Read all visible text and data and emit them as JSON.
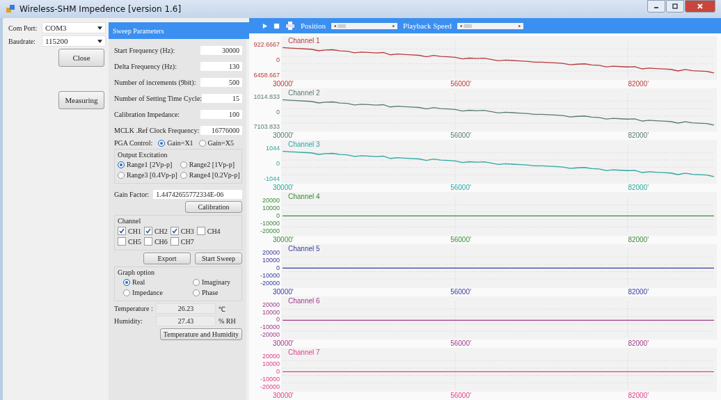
{
  "window": {
    "title": "Wireless-SHM Impedence [version 1.6]"
  },
  "connection": {
    "com_port": {
      "label": "Com Port:",
      "value": "COM3"
    },
    "baudrate": {
      "label": "Baudrate:",
      "value": "115200"
    },
    "close_button": "Close",
    "measuring_button": "Measuring"
  },
  "sweep": {
    "header": "Sweep Parameters",
    "fields": [
      {
        "label": "Start Frequency (Hz):",
        "value": "30000"
      },
      {
        "label": "Delta Frequency (Hz):",
        "value": "130"
      },
      {
        "label": "Number of increments (9bit):",
        "value": "500"
      },
      {
        "label": "Number of Setting Time Cycle:",
        "value": "15"
      },
      {
        "label": "Calibration Impedance:",
        "value": "100"
      },
      {
        "label": "MCLK .Ref Clock Frequency:",
        "value": "16776000"
      }
    ],
    "pga": {
      "label": "PGA Control:",
      "options": [
        {
          "label": "Gain=X1",
          "selected": true
        },
        {
          "label": "Gain=X5",
          "selected": false
        }
      ]
    },
    "output_excitation": {
      "title": "Output Excitation",
      "options": [
        {
          "label": "Range1 [2Vp-p]",
          "selected": true
        },
        {
          "label": "Range2 [1Vp-p]",
          "selected": false
        },
        {
          "label": "Range3 [0.4Vp-p]",
          "selected": false
        },
        {
          "label": "Range4 [0.2Vp-p]",
          "selected": false
        }
      ]
    },
    "gain_factor": {
      "label": "Gain Factor:",
      "value": "1.44742655772334E-06"
    },
    "calibration_button": "Calibration",
    "channel": {
      "title": "Channel",
      "items": [
        {
          "label": "CH1",
          "checked": true
        },
        {
          "label": "CH2",
          "checked": true
        },
        {
          "label": "CH3",
          "checked": true
        },
        {
          "label": "CH4",
          "checked": false
        },
        {
          "label": "CH5",
          "checked": false
        },
        {
          "label": "CH6",
          "checked": false
        },
        {
          "label": "CH7",
          "checked": false
        }
      ]
    },
    "export_button": "Export",
    "start_sweep_button": "Start Sweep",
    "graph_option": {
      "title": "Graph option",
      "options": [
        {
          "label": "Real",
          "selected": true
        },
        {
          "label": "Imaginary",
          "selected": false
        },
        {
          "label": "Impedance",
          "selected": false
        },
        {
          "label": "Phase",
          "selected": false
        }
      ]
    },
    "temperature": {
      "label": "Temperature :",
      "value": "26.23",
      "unit": "℃"
    },
    "humidity": {
      "label": "Humidity:",
      "value": "27.43",
      "unit": "% RH"
    },
    "temp_humidity_button": "Temperature and Humidity"
  },
  "toolbar": {
    "position_label": "Position",
    "playback_speed_label": "Playback Speed"
  },
  "charts": [
    {
      "title": "Channel 1",
      "color": "#b83a3a",
      "kind": "falling",
      "y_labels": [
        "922.6667",
        "0",
        "6458.667"
      ],
      "x_labels": [
        "30000'",
        "56000'",
        "82000'"
      ]
    },
    {
      "title": "Channel 2",
      "color": "#5a7a70",
      "kind": "falling",
      "y_labels": [
        "1014.833",
        "0",
        "7103.833"
      ],
      "x_labels": [
        "30000'",
        "56000'",
        "82000'"
      ]
    },
    {
      "title": "Channel 3",
      "color": "#2aa6a0",
      "kind": "falling",
      "y_labels": [
        "1044",
        "0",
        "-1044"
      ],
      "x_labels": [
        "30000'",
        "56000'",
        "82000'"
      ]
    },
    {
      "title": "Channel 4",
      "color": "#3a8a3a",
      "kind": "flat",
      "y_labels": [
        "20000",
        "10000",
        "0",
        "-10000",
        "-20000"
      ],
      "x_labels": [
        "30000'",
        "56000'",
        "82000'"
      ]
    },
    {
      "title": "Channel 5",
      "color": "#3a3aa0",
      "kind": "flat",
      "y_labels": [
        "20000",
        "10000",
        "0",
        "-10000",
        "-20000"
      ],
      "x_labels": [
        "30000'",
        "56000'",
        "82000'"
      ]
    },
    {
      "title": "Channel 6",
      "color": "#a03a8a",
      "kind": "flat",
      "y_labels": [
        "20000",
        "10000",
        "0",
        "-10000",
        "-20000"
      ],
      "x_labels": [
        "30000'",
        "56000'",
        "82000'"
      ]
    },
    {
      "title": "Channel 7",
      "color": "#e0408a",
      "kind": "flat",
      "y_labels": [
        "20000",
        "10000",
        "0",
        "-10000",
        "-20000"
      ],
      "x_labels": [
        "30000'",
        "56000'",
        "82000'"
      ]
    }
  ]
}
